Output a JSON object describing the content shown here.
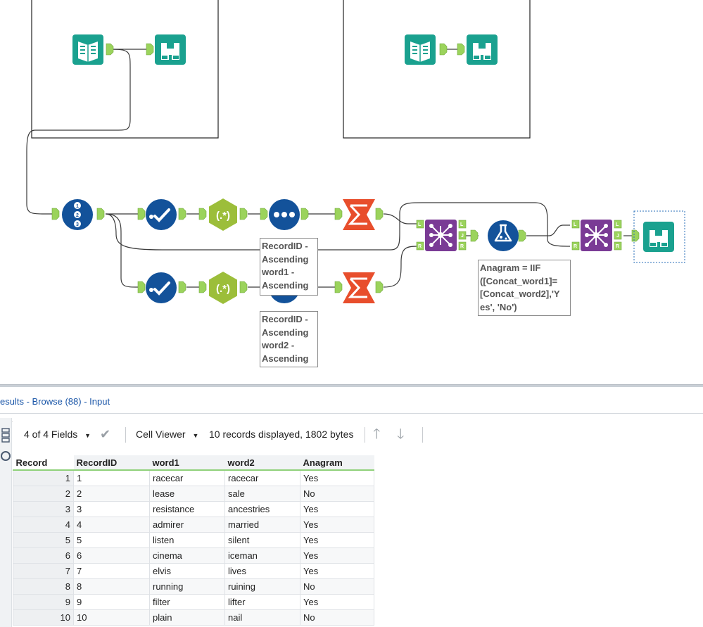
{
  "canvas": {
    "annotations": {
      "sort1": "RecordID -\nAscending\nword1 -\nAscending",
      "sort2": "RecordID -\nAscending\nword2 -\nAscending",
      "formula": "Anagram = IIF\n([Concat_word1]=\n[Concat_word2],'Y\nes', 'No')"
    },
    "anchor_labels": {
      "left": "L",
      "join": "J",
      "right": "R"
    },
    "tool_icons": [
      "input-tool-icon",
      "browse-tool-icon",
      "recordid-tool-icon",
      "tokenize-tool-icon",
      "regex-tool-icon",
      "sort-tool-icon",
      "summarize-tool-icon",
      "join-tool-icon",
      "formula-tool-icon"
    ],
    "colors": {
      "input_teal": "#1aa18f",
      "prep_blue": "#13529a",
      "parse_green": "#9cbe3a",
      "summarize_red": "#e84e2c",
      "join_purple": "#7a3b95",
      "anchor_green": "#9bd35c",
      "selection": "#2a6fb8"
    }
  },
  "results": {
    "title": "esults - Browse (88) - Input",
    "toolbar": {
      "fields": "4 of 4 Fields",
      "viewer": "Cell Viewer",
      "summary": "10 records displayed, 1802 bytes"
    },
    "columns": [
      "Record",
      "RecordID",
      "word1",
      "word2",
      "Anagram"
    ],
    "rows": [
      [
        "1",
        "1",
        "racecar",
        "racecar",
        "Yes"
      ],
      [
        "2",
        "2",
        "lease",
        "sale",
        "No"
      ],
      [
        "3",
        "3",
        "resistance",
        "ancestries",
        "Yes"
      ],
      [
        "4",
        "4",
        "admirer",
        "married",
        "Yes"
      ],
      [
        "5",
        "5",
        "listen",
        "silent",
        "Yes"
      ],
      [
        "6",
        "6",
        "cinema",
        "iceman",
        "Yes"
      ],
      [
        "7",
        "7",
        "elvis",
        "lives",
        "Yes"
      ],
      [
        "8",
        "8",
        "running",
        "ruining",
        "No"
      ],
      [
        "9",
        "9",
        "filter",
        "lifter",
        "Yes"
      ],
      [
        "10",
        "10",
        "plain",
        "nail",
        "No"
      ]
    ]
  }
}
